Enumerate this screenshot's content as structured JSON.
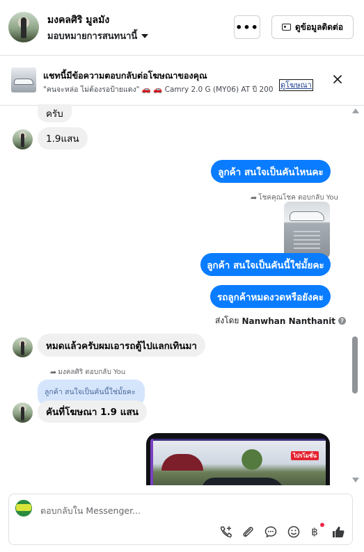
{
  "header": {
    "name": "มงคลศิริ มูลมัง",
    "assign_label": "มอบหมายการสนทนานี้",
    "more_label": "•••",
    "contact_label": "ดูข้อมูลติดต่อ"
  },
  "ad_banner": {
    "title": "แชทนี้มีข้อความตอบกลับต่อโฆษณาของคุณ",
    "subtitle": "\"คนจะหล่อ ไม่ต้องรอป้ายแดง\" 🚗 🚗 Camry 2.0 G (MY06) AT ปี 2007 ...",
    "link_label": "ดูโฆษณา"
  },
  "messages": [
    {
      "id": "m1",
      "side": "in",
      "text": "ครับ"
    },
    {
      "id": "m2",
      "side": "in",
      "text": "1.9แสน"
    },
    {
      "id": "m3",
      "side": "out",
      "text": "ลูกค้า สนใจเป็นคันไหนคะ"
    },
    {
      "id": "m4",
      "side": "out",
      "reply_label": "โชคคุณโชค ตอบกลับ You",
      "text": "ลูกค้า สนใจเป็นคันนี้ใช่มั้ยคะ"
    },
    {
      "id": "m5",
      "side": "out",
      "text": "รถลูกค้าหมดงวดหรือยังคะ",
      "sent_by_prefix": "ส่งโดย",
      "sent_by_name": "Nanwhan Nanthanit"
    },
    {
      "id": "m6",
      "side": "in",
      "text": "หมดแล้วครับผมเอารถตู้ไปแลกเทินมา"
    },
    {
      "id": "m7",
      "side": "in",
      "reply_label": "มงคลศิริ ตอบกลับ You",
      "quoted": "ลูกค้า สนใจเป็นคันนี้ใช่มั้ยคะ",
      "text": "คันที่โฆษณา 1.9 แสน"
    }
  ],
  "ad_image_badge": "ไปรโมชั่น",
  "composer": {
    "placeholder": "ตอบกลับใน Messenger...",
    "tools": [
      "call-add-icon",
      "attachment-icon",
      "chat-bubble-icon",
      "emoji-icon",
      "baht-payment-icon",
      "thumbs-up-icon"
    ],
    "baht_symbol": "฿"
  },
  "colors": {
    "outgoing_bubble": "#0a7cff",
    "incoming_bubble": "#f0f0f0",
    "quoted_bubble": "#d5e5fc",
    "notification_dot": "#f02849"
  }
}
